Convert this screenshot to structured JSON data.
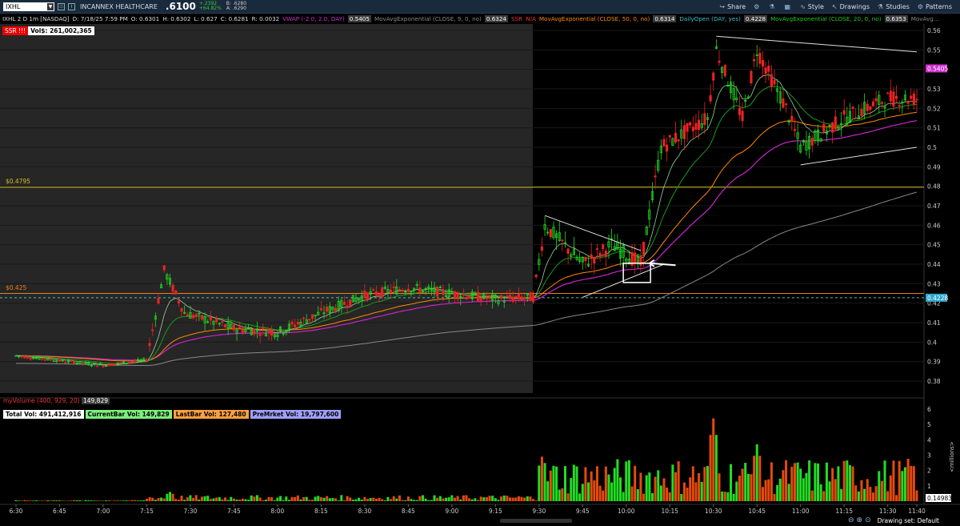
{
  "topbar": {
    "symbol": "IXHL",
    "company": "INCANNEX HEALTHCARE",
    "last_price": ".6100",
    "change_line1": "+.2392",
    "change_line2": "+64.82%",
    "bid": "B: .6280",
    "ask": "A: .6290",
    "buttons": {
      "share": "Share",
      "style": "Style",
      "drawings": "Drawings",
      "studies": "Studies",
      "patterns": "Patterns"
    }
  },
  "studies": {
    "title": "IXHL 2 D 1m [NASDAQ]",
    "datetime": "D: 7/18/25 7:59 PM",
    "open": "O: 0.6301",
    "high": "H: 0.6302",
    "low": "L: 0.627",
    "close": "C: 0.6281",
    "range": "R: 0.0032",
    "vwap_label": "VWAP (-2.0, 2.0, DAY)",
    "vwap_val": "0.5405",
    "ema9_label": "MovAvgExponential (CLOSE, 9, 0, no)",
    "ema9_val": "0.6324",
    "ssr": "SSR",
    "na": "N/A",
    "ema50_label": "MovAvgExponential (CLOSE, 50, 0, no)",
    "ema50_val": "0.6314",
    "dailyopen_label": "DailyOpen (DAY, yes)",
    "dailyopen_val": "0.4228",
    "ema20_label": "MovAvgExponential (CLOSE, 20, 0, no)",
    "ema20_val": "0.6353",
    "more": "MovAvg..."
  },
  "badges": {
    "ssr": "SSR !!!",
    "vol": "Vol$: 261,002,365"
  },
  "hlines": {
    "upper": "$0.4795",
    "lower": "$0.425"
  },
  "price_axis": {
    "ticks": [
      "0.56",
      "0.55",
      "0.54",
      "0.53",
      "0.52",
      "0.51",
      "0.5",
      "0.49",
      "0.48",
      "0.47",
      "0.46",
      "0.45",
      "0.44",
      "0.43",
      "0.42",
      "0.41",
      "0.4",
      "0.39",
      "0.38"
    ],
    "marker_vwap": "0.5405",
    "marker_open": "0.4228"
  },
  "volume": {
    "label": "myVolume (400, 929, 20)",
    "value": "149,829",
    "total": "Total Vol: 491,412,916",
    "current": "CurrentBar Vol: 149,829",
    "last": "LastBar Vol: 127,480",
    "premarket": "PreMrket Vol: 19,797,600",
    "axis": [
      "6",
      "5",
      "4",
      "3",
      "2",
      "1"
    ],
    "axis_unit": "<millions>",
    "marker": "0.14983"
  },
  "time_axis": [
    "6:30",
    "6:45",
    "7:00",
    "7:15",
    "7:30",
    "7:45",
    "8:00",
    "8:15",
    "8:30",
    "8:45",
    "9:00",
    "9:15",
    "9:30",
    "9:45",
    "10:00",
    "10:15",
    "10:30",
    "10:45",
    "11:00",
    "11:15",
    "11:30",
    "11:40"
  ],
  "footer": {
    "drawing_set": "Drawing set: Default"
  },
  "colors": {
    "up": "#22dd22",
    "down": "#ee2222",
    "vwap": "#cc22cc",
    "ema_orange": "#ff8800",
    "ema_green": "#22cc22",
    "premarket_bg": "#262626",
    "hline_yellow": "#d8c020",
    "hline_orange": "#e88020",
    "daily_open": "#40c0d0"
  },
  "chart_data": {
    "type": "candlestick",
    "x_start": "6:30",
    "x_end": "11:40",
    "ylim": [
      0.375,
      0.565
    ],
    "levels": [
      0.4795,
      0.425,
      0.4228
    ],
    "keypoints_price": [
      [
        "6:30",
        0.393
      ],
      [
        "7:00",
        0.388
      ],
      [
        "7:15",
        0.391
      ],
      [
        "7:21",
        0.437
      ],
      [
        "7:28",
        0.415
      ],
      [
        "7:45",
        0.407
      ],
      [
        "8:00",
        0.405
      ],
      [
        "8:15",
        0.415
      ],
      [
        "8:30",
        0.424
      ],
      [
        "8:45",
        0.428
      ],
      [
        "9:00",
        0.425
      ],
      [
        "9:15",
        0.422
      ],
      [
        "9:28",
        0.423
      ],
      [
        "9:32",
        0.46
      ],
      [
        "9:45",
        0.44
      ],
      [
        "9:55",
        0.45
      ],
      [
        "10:05",
        0.44
      ],
      [
        "10:12",
        0.5
      ],
      [
        "10:28",
        0.515
      ],
      [
        "10:31",
        0.55
      ],
      [
        "10:40",
        0.515
      ],
      [
        "10:45",
        0.55
      ],
      [
        "10:55",
        0.52
      ],
      [
        "11:00",
        0.5
      ],
      [
        "11:15",
        0.515
      ],
      [
        "11:30",
        0.525
      ],
      [
        "11:40",
        0.525
      ]
    ],
    "volume_peaks_millions": [
      [
        "7:23",
        0.6
      ],
      [
        "9:31",
        2.9
      ],
      [
        "10:30",
        5.4
      ],
      [
        "10:45",
        3.7
      ],
      [
        "11:38",
        2.3
      ]
    ]
  }
}
